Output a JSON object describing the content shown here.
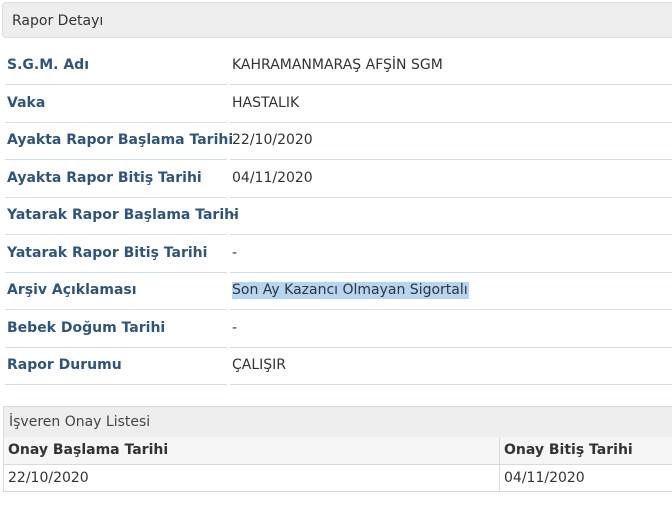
{
  "panel": {
    "title": "Rapor Detayı"
  },
  "details": [
    {
      "label": "S.G.M. Adı",
      "value": "KAHRAMANMARAŞ AFŞİN SGM"
    },
    {
      "label": "Vaka",
      "value": "HASTALIK"
    },
    {
      "label": "Ayakta Rapor Başlama Tarihi",
      "value": "22/10/2020"
    },
    {
      "label": "Ayakta Rapor Bitiş Tarihi",
      "value": "04/11/2020"
    },
    {
      "label": "Yatarak Rapor Başlama Tarihi",
      "value": "-"
    },
    {
      "label": "Yatarak Rapor Bitiş Tarihi",
      "value": "-"
    },
    {
      "label": "Arşiv Açıklaması",
      "value": "Son Ay Kazancı Olmayan Sigortalı"
    },
    {
      "label": "Bebek Doğum Tarihi",
      "value": "-"
    },
    {
      "label": "Rapor Durumu",
      "value": "ÇALIŞIR"
    }
  ],
  "approval": {
    "title": "İşveren Onay Listesi",
    "columns": [
      "Onay Başlama Tarihi",
      "Onay Bitiş Tarihi"
    ],
    "rows": [
      [
        "22/10/2020",
        "04/11/2020"
      ]
    ]
  }
}
